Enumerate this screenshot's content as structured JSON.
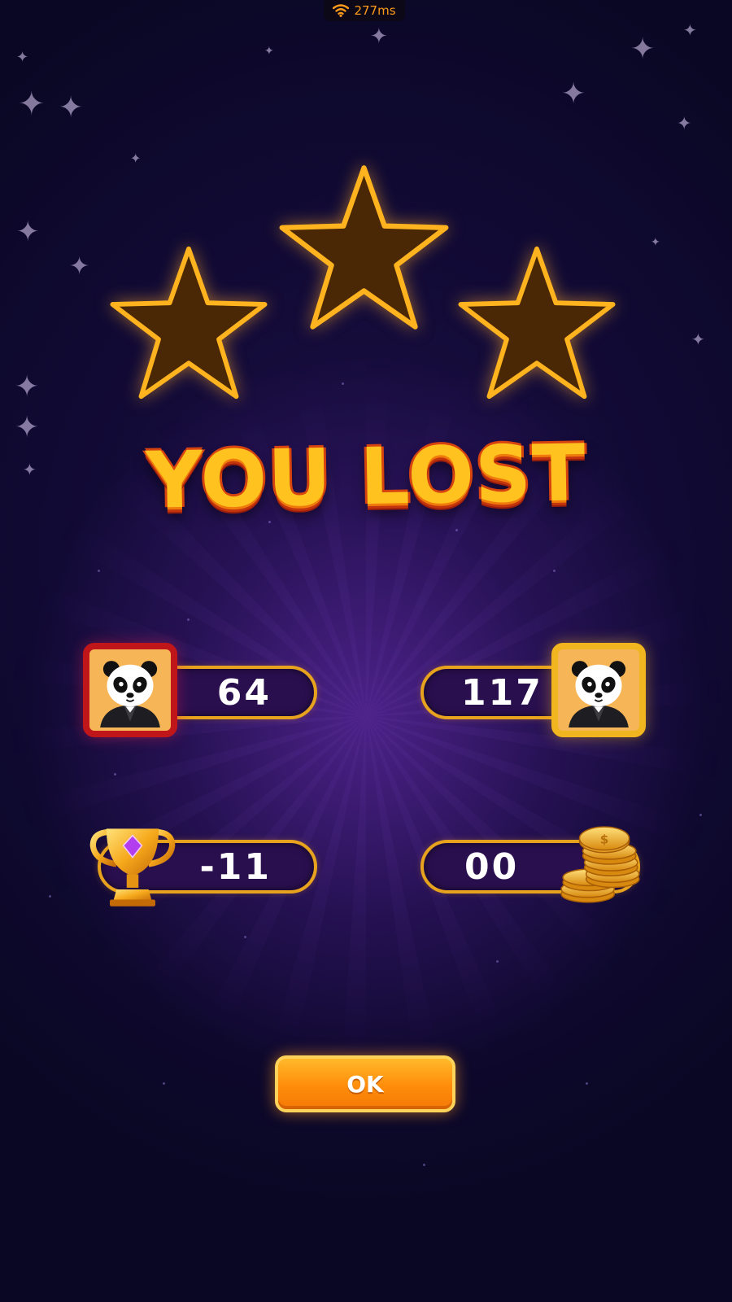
{
  "status_bar": {
    "ping": "277ms",
    "ping_icon": "wifi-icon",
    "accent": "#ff9b1a"
  },
  "stars": {
    "earned": 0,
    "total": 3,
    "fill_color": "#4a2806",
    "outline_color": "#ffb31e"
  },
  "result": {
    "title": "YOU LOST"
  },
  "players": {
    "self": {
      "score": "64",
      "avatar_icon": "panda-icon",
      "frame_color": "#c0161a"
    },
    "opponent": {
      "score": "117",
      "avatar_icon": "panda-icon",
      "frame_color": "#f1b51f"
    }
  },
  "rewards": {
    "trophies": {
      "value": "-11",
      "icon": "trophy-icon"
    },
    "coins": {
      "value": "00",
      "icon": "coins-icon"
    }
  },
  "actions": {
    "ok_label": "OK"
  }
}
